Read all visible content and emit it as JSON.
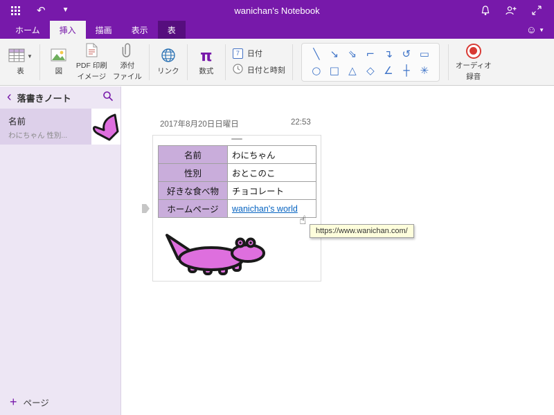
{
  "titlebar": {
    "title": "wanichan's Notebook"
  },
  "tabs": [
    {
      "label": "ホーム"
    },
    {
      "label": "挿入"
    },
    {
      "label": "描画"
    },
    {
      "label": "表示"
    },
    {
      "label": "表"
    }
  ],
  "ribbon": {
    "table": "表",
    "picture": "図",
    "pdf_line1": "PDF 印刷",
    "pdf_line2": "イメージ",
    "attach_line1": "添付",
    "attach_line2": "ファイル",
    "link": "リンク",
    "equation": "数式",
    "date": "日付",
    "datetime": "日付と時刻",
    "date_icon_day": "7",
    "audio_line1": "オーディオ",
    "audio_line2": "録音",
    "shapes_row1": [
      "╲",
      "↘",
      "⇘",
      "⌐",
      "↴",
      "↺",
      "▭"
    ],
    "shapes_row2": [
      "○",
      "□",
      "△",
      "◇",
      "∠",
      "┼",
      "✳"
    ]
  },
  "sidebar": {
    "notebook_title": "落書きノート",
    "pages": [
      {
        "title": "名前",
        "preview": "わにちゃん 性別..."
      }
    ],
    "add_page_label": "ページ"
  },
  "content": {
    "date": "2017年8月20日日曜日",
    "time": "22:53",
    "table": {
      "rows": [
        {
          "label": "名前",
          "value": "わにちゃん"
        },
        {
          "label": "性別",
          "value": "おとこのこ"
        },
        {
          "label": "好きな食べ物",
          "value": "チョコレート"
        },
        {
          "label": "ホームページ",
          "value": "wanichan's world"
        }
      ]
    },
    "tooltip": "https://www.wanichan.com/"
  },
  "colors": {
    "accent": "#7719AA",
    "contextual_tab": "#560E7E",
    "table_header_bg": "#C9ADDB",
    "link": "#0563C1",
    "doodle": "#DE6FDE",
    "record_red": "#D83A34",
    "shape_blue": "#3F74C8"
  }
}
